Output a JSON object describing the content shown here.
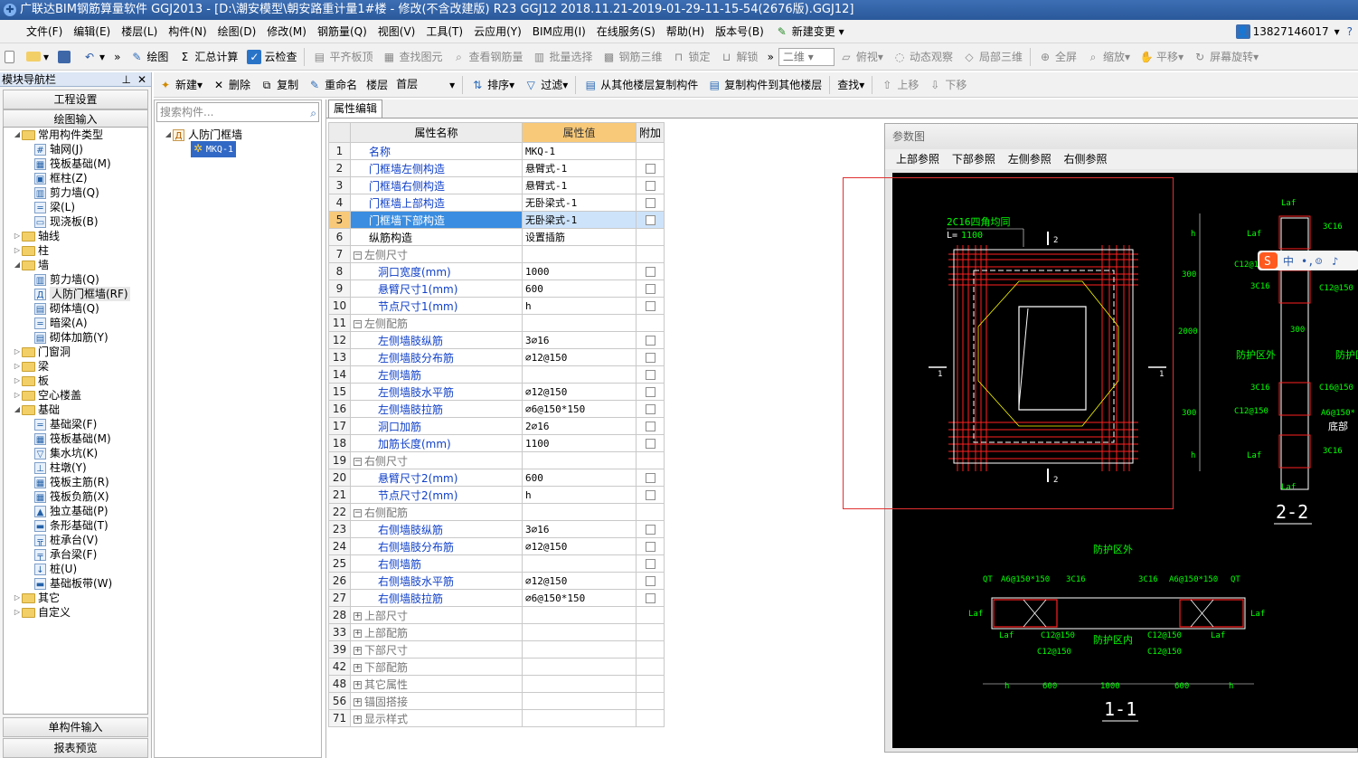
{
  "title": "广联达BIM钢筋算量软件 GGJ2013 - [D:\\潮安模型\\朝安路重计量1#楼 - 修改(不含改建版) R23 GGJ12 2018.11.21-2019-01-29-11-15-54(2676版).GGJ12]",
  "menu": [
    "文件(F)",
    "编辑(E)",
    "楼层(L)",
    "构件(N)",
    "绘图(D)",
    "修改(M)",
    "钢筋量(Q)",
    "视图(V)",
    "工具(T)",
    "云应用(Y)",
    "BIM应用(I)",
    "在线服务(S)",
    "帮助(H)",
    "版本号(B)"
  ],
  "menu_new_change": "新建变更",
  "phone": "13827146017",
  "toolbar": {
    "draw": "绘图",
    "sum": "汇总计算",
    "cloud_check": "云检查",
    "align": "平齐板顶",
    "find_elem": "查找图元",
    "view_rebar": "查看钢筋量",
    "batch": "批量选择",
    "rebar3d": "钢筋三维",
    "lock": "锁定",
    "unlock": "解锁",
    "view2d": "二维",
    "top": "俯视",
    "dynamic": "动态观察",
    "local3d": "局部三维",
    "full": "全屏",
    "zoom": "缩放",
    "pan": "平移",
    "rotate": "屏幕旋转"
  },
  "toolbar2": {
    "new": "新建",
    "delete": "删除",
    "copy": "复制",
    "rename": "重命名",
    "floor_label": "楼层",
    "floor_value": "首层",
    "sort": "排序",
    "filter": "过滤",
    "copy_from": "从其他楼层复制构件",
    "copy_to": "复制构件到其他楼层",
    "find": "查找",
    "up": "上移",
    "down": "下移"
  },
  "left": {
    "header": "模块导航栏",
    "project_settings": "工程设置",
    "drawing_input": "绘图输入",
    "single_input": "单构件输入",
    "report_preview": "报表预览",
    "tree": [
      {
        "lvl": 0,
        "exp": "◢",
        "type": "folder",
        "label": "常用构件类型"
      },
      {
        "lvl": 1,
        "type": "leaf",
        "glyph": "#",
        "label": "轴网(J)"
      },
      {
        "lvl": 1,
        "type": "leaf",
        "glyph": "▦",
        "label": "筏板基础(M)"
      },
      {
        "lvl": 1,
        "type": "leaf",
        "glyph": "▣",
        "label": "框柱(Z)"
      },
      {
        "lvl": 1,
        "type": "leaf",
        "glyph": "▥",
        "label": "剪力墙(Q)"
      },
      {
        "lvl": 1,
        "type": "leaf",
        "glyph": "═",
        "label": "梁(L)"
      },
      {
        "lvl": 1,
        "type": "leaf",
        "glyph": "▭",
        "label": "现浇板(B)"
      },
      {
        "lvl": 0,
        "exp": "▷",
        "type": "folder",
        "label": "轴线"
      },
      {
        "lvl": 0,
        "exp": "▷",
        "type": "folder",
        "label": "柱"
      },
      {
        "lvl": 0,
        "exp": "◢",
        "type": "folder",
        "label": "墙"
      },
      {
        "lvl": 1,
        "type": "leaf",
        "glyph": "▥",
        "label": "剪力墙(Q)"
      },
      {
        "lvl": 1,
        "type": "leaf",
        "glyph": "Д",
        "label": "人防门框墙(RF)"
      },
      {
        "lvl": 1,
        "type": "leaf",
        "glyph": "▤",
        "label": "砌体墙(Q)"
      },
      {
        "lvl": 1,
        "type": "leaf",
        "glyph": "═",
        "label": "暗梁(A)"
      },
      {
        "lvl": 1,
        "type": "leaf",
        "glyph": "▤",
        "label": "砌体加筋(Y)"
      },
      {
        "lvl": 0,
        "exp": "▷",
        "type": "folder",
        "label": "门窗洞"
      },
      {
        "lvl": 0,
        "exp": "▷",
        "type": "folder",
        "label": "梁"
      },
      {
        "lvl": 0,
        "exp": "▷",
        "type": "folder",
        "label": "板"
      },
      {
        "lvl": 0,
        "exp": "▷",
        "type": "folder",
        "label": "空心楼盖"
      },
      {
        "lvl": 0,
        "exp": "◢",
        "type": "folder",
        "label": "基础"
      },
      {
        "lvl": 1,
        "type": "leaf",
        "glyph": "═",
        "label": "基础梁(F)"
      },
      {
        "lvl": 1,
        "type": "leaf",
        "glyph": "▦",
        "label": "筏板基础(M)"
      },
      {
        "lvl": 1,
        "type": "leaf",
        "glyph": "▽",
        "label": "集水坑(K)"
      },
      {
        "lvl": 1,
        "type": "leaf",
        "glyph": "⊥",
        "label": "柱墩(Y)"
      },
      {
        "lvl": 1,
        "type": "leaf",
        "glyph": "▦",
        "label": "筏板主筋(R)"
      },
      {
        "lvl": 1,
        "type": "leaf",
        "glyph": "▦",
        "label": "筏板负筋(X)"
      },
      {
        "lvl": 1,
        "type": "leaf",
        "glyph": "▲",
        "label": "独立基础(P)"
      },
      {
        "lvl": 1,
        "type": "leaf",
        "glyph": "▬",
        "label": "条形基础(T)"
      },
      {
        "lvl": 1,
        "type": "leaf",
        "glyph": "╦",
        "label": "桩承台(V)"
      },
      {
        "lvl": 1,
        "type": "leaf",
        "glyph": "╤",
        "label": "承台梁(F)"
      },
      {
        "lvl": 1,
        "type": "leaf",
        "glyph": "↓",
        "label": "桩(U)"
      },
      {
        "lvl": 1,
        "type": "leaf",
        "glyph": "▬",
        "label": "基础板带(W)"
      },
      {
        "lvl": 0,
        "exp": "▷",
        "type": "folder",
        "label": "其它"
      },
      {
        "lvl": 0,
        "exp": "▷",
        "type": "folder",
        "label": "自定义"
      }
    ]
  },
  "mid": {
    "search_placeholder": "搜索构件...",
    "root": "人防门框墙",
    "child": "MKQ-1"
  },
  "prop": {
    "tab": "属性编辑",
    "col_name": "属性名称",
    "col_value": "属性值",
    "col_extra": "附加",
    "rows": [
      {
        "n": "1",
        "name": "名称",
        "val": "MKQ-1",
        "style": "normal",
        "cb": false
      },
      {
        "n": "2",
        "name": "门框墙左侧构造",
        "val": "悬臂式-1",
        "style": "normal",
        "cb": true
      },
      {
        "n": "3",
        "name": "门框墙右侧构造",
        "val": "悬臂式-1",
        "style": "normal",
        "cb": true
      },
      {
        "n": "4",
        "name": "门框墙上部构造",
        "val": "无卧梁式-1",
        "style": "normal",
        "cb": true
      },
      {
        "n": "5",
        "name": "门框墙下部构造",
        "val": "无卧梁式-1",
        "style": "normal",
        "cb": true,
        "hl": true
      },
      {
        "n": "6",
        "name": "纵筋构造",
        "val": "设置插筋",
        "style": "black",
        "cb": false
      },
      {
        "n": "7",
        "name": "左侧尺寸",
        "val": "",
        "style": "group",
        "box": "−",
        "cb": false
      },
      {
        "n": "8",
        "name": "洞口宽度(mm)",
        "val": "1000",
        "style": "ind",
        "cb": true
      },
      {
        "n": "9",
        "name": "悬臂尺寸1(mm)",
        "val": "600",
        "style": "ind",
        "cb": true
      },
      {
        "n": "10",
        "name": "节点尺寸1(mm)",
        "val": "h",
        "style": "ind",
        "cb": true
      },
      {
        "n": "11",
        "name": "左侧配筋",
        "val": "",
        "style": "group",
        "box": "−",
        "cb": false
      },
      {
        "n": "12",
        "name": "左侧墙肢纵筋",
        "val": "3⌀16",
        "style": "ind",
        "cb": true
      },
      {
        "n": "13",
        "name": "左侧墙肢分布筋",
        "val": "⌀12@150",
        "style": "ind",
        "cb": true
      },
      {
        "n": "14",
        "name": "左侧墙筋",
        "val": "",
        "style": "ind",
        "cb": true
      },
      {
        "n": "15",
        "name": "左侧墙肢水平筋",
        "val": "⌀12@150",
        "style": "ind",
        "cb": true
      },
      {
        "n": "16",
        "name": "左侧墙肢拉筋",
        "val": "⌀6@150*150",
        "style": "ind",
        "cb": true
      },
      {
        "n": "17",
        "name": "洞口加筋",
        "val": "2⌀16",
        "style": "ind",
        "cb": true
      },
      {
        "n": "18",
        "name": "加筋长度(mm)",
        "val": "1100",
        "style": "ind",
        "cb": true
      },
      {
        "n": "19",
        "name": "右侧尺寸",
        "val": "",
        "style": "group",
        "box": "−",
        "cb": false
      },
      {
        "n": "20",
        "name": "悬臂尺寸2(mm)",
        "val": "600",
        "style": "ind",
        "cb": true
      },
      {
        "n": "21",
        "name": "节点尺寸2(mm)",
        "val": "h",
        "style": "ind",
        "cb": true
      },
      {
        "n": "22",
        "name": "右侧配筋",
        "val": "",
        "style": "group",
        "box": "−",
        "cb": false
      },
      {
        "n": "23",
        "name": "右侧墙肢纵筋",
        "val": "3⌀16",
        "style": "ind",
        "cb": true
      },
      {
        "n": "24",
        "name": "右侧墙肢分布筋",
        "val": "⌀12@150",
        "style": "ind",
        "cb": true
      },
      {
        "n": "25",
        "name": "右侧墙筋",
        "val": "",
        "style": "ind",
        "cb": true
      },
      {
        "n": "26",
        "name": "右侧墙肢水平筋",
        "val": "⌀12@150",
        "style": "ind",
        "cb": true
      },
      {
        "n": "27",
        "name": "右侧墙肢拉筋",
        "val": "⌀6@150*150",
        "style": "ind",
        "cb": true
      },
      {
        "n": "28",
        "name": "上部尺寸",
        "val": "",
        "style": "group",
        "box": "+",
        "cb": false
      },
      {
        "n": "33",
        "name": "上部配筋",
        "val": "",
        "style": "group",
        "box": "+",
        "cb": false
      },
      {
        "n": "39",
        "name": "下部尺寸",
        "val": "",
        "style": "group",
        "box": "+",
        "cb": false
      },
      {
        "n": "42",
        "name": "下部配筋",
        "val": "",
        "style": "group",
        "box": "+",
        "cb": false
      },
      {
        "n": "48",
        "name": "其它属性",
        "val": "",
        "style": "group",
        "box": "+",
        "cb": false
      },
      {
        "n": "56",
        "name": "锚固搭接",
        "val": "",
        "style": "group",
        "box": "+",
        "cb": false
      },
      {
        "n": "71",
        "name": "显示样式",
        "val": "",
        "style": "group",
        "box": "+",
        "cb": false
      }
    ]
  },
  "diagram": {
    "title": "参数图",
    "links": [
      "上部参照",
      "下部参照",
      "左侧参照",
      "右侧参照"
    ],
    "labels": {
      "rebar_note": "2C16四角均同",
      "L_prefix": "L=",
      "L_value": "1100",
      "sec1": "1",
      "sec2": "2",
      "laf": "Laf",
      "h": "h",
      "d300": "300",
      "d2000": "2000",
      "c3c16": "3C16",
      "c12150": "C12@150",
      "c16150": "C16@150",
      "a6": "A6@150*",
      "fhqw": "防护区外",
      "fhqn": "防护区内",
      "fhqw_v": "防护\n区外",
      "fhqn_v": "防护\n区内",
      "dbm": "底部",
      "s22": "2-2",
      "s11": "1-1",
      "qt": "QT",
      "a6full": "A6@150*150",
      "d600": "600",
      "d1000": "1000",
      "ime": "中"
    }
  },
  "colors": {
    "rebar_red": "#ff2020",
    "cad_green": "#00ff00",
    "cad_yellow": "#ffff00",
    "cad_white": "#ffffff",
    "highlight": "#3a8de0",
    "header_orange": "#f8c978"
  }
}
